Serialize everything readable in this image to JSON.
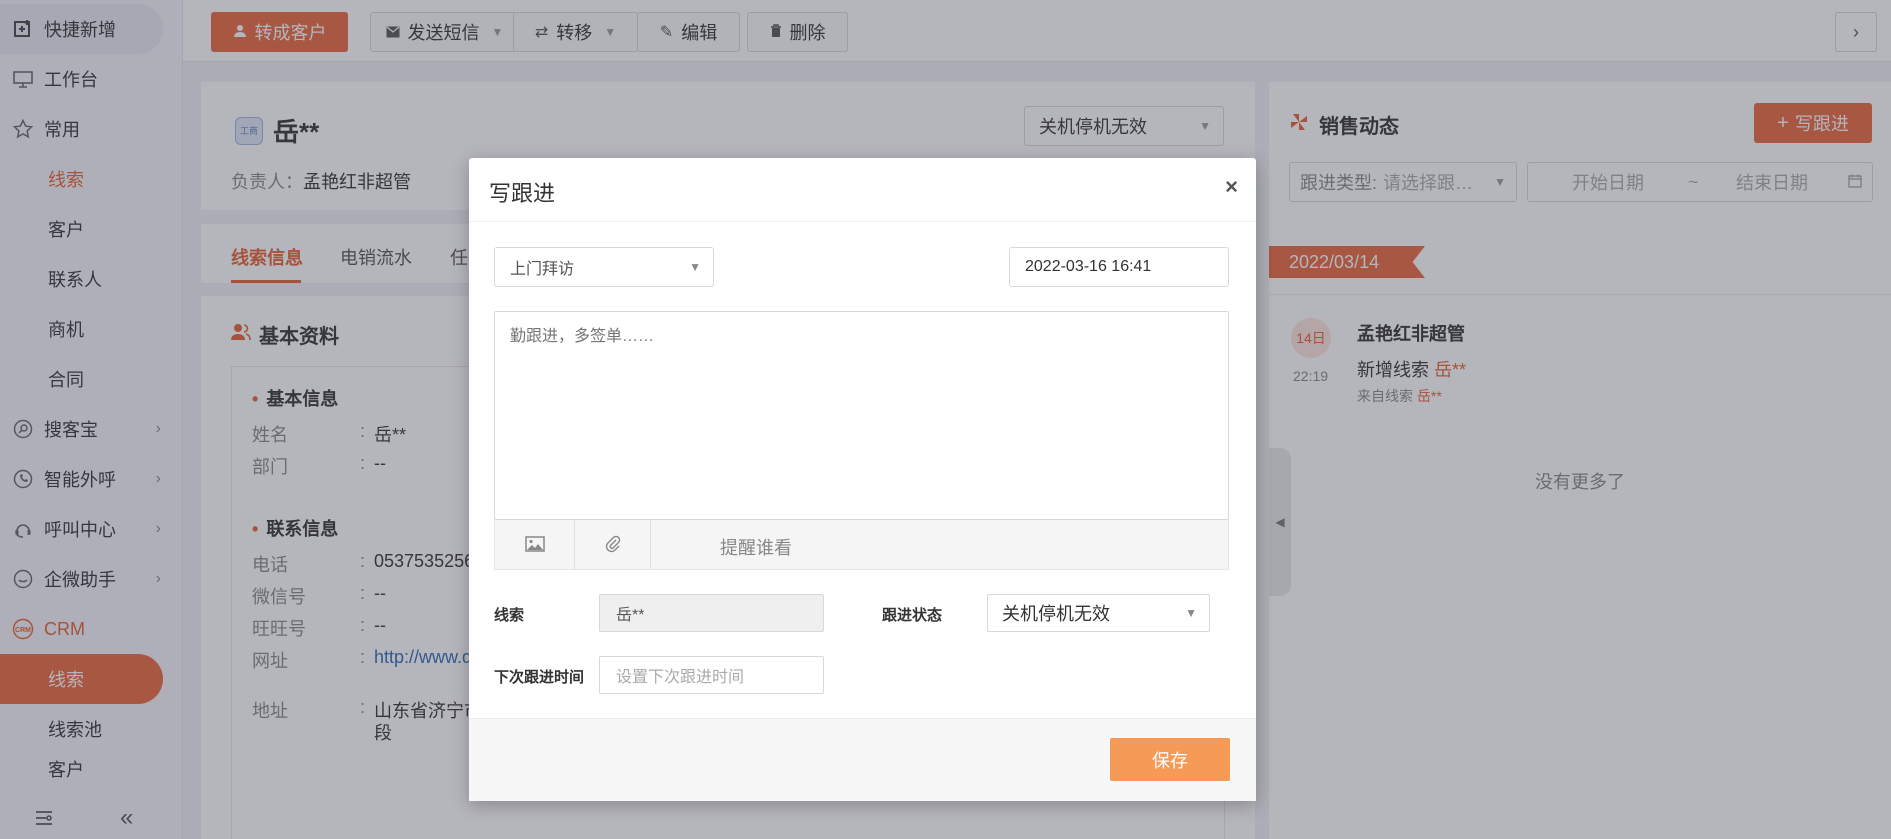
{
  "sidebar": {
    "quick_add": "快捷新增",
    "workbench": "工作台",
    "common": "常用",
    "common_items": [
      "线索",
      "客户",
      "联系人",
      "商机",
      "合同"
    ],
    "souke": "搜客宝",
    "smart_call": "智能外呼",
    "call_center": "呼叫中心",
    "wecom": "企微助手",
    "crm": "CRM",
    "crm_items": [
      "线索",
      "线索池",
      "客户"
    ]
  },
  "toolbar": {
    "convert": "转成客户",
    "sms": "发送短信",
    "transfer": "转移",
    "edit": "编辑",
    "delete": "删除"
  },
  "lead": {
    "name": "岳**",
    "badge_text": "工商",
    "owner_label": "负责人：",
    "owner": "孟艳红非超管",
    "status": "关机停机无效"
  },
  "tabs": [
    "线索信息",
    "电销流水",
    "任"
  ],
  "info": {
    "title": "基本资料",
    "section_basic": "基本信息",
    "section_contact": "联系信息",
    "fields_basic": [
      {
        "label": "姓名",
        "value": "岳**"
      },
      {
        "label": "部门",
        "value": "--"
      }
    ],
    "fields_contact": [
      {
        "label": "电话",
        "value": "05375352567"
      },
      {
        "label": "微信号",
        "value": "--"
      },
      {
        "label": "旺旺号",
        "value": "--"
      },
      {
        "label": "网址",
        "value": "http://www.d"
      },
      {
        "label": "地址",
        "value": "山东省济宁市",
        "value2": "段"
      }
    ]
  },
  "right_panel": {
    "title": "销售动态",
    "write_button": "写跟进",
    "filter_label": "跟进类型:",
    "filter_placeholder": "请选择跟…",
    "start_date": "开始日期",
    "tilde": "~",
    "end_date": "结束日期",
    "date_tag": "2022/03/14",
    "day": "14日",
    "time": "22:19",
    "user": "孟艳红非超管",
    "action_prefix": "新增线索",
    "action_name": "岳**",
    "source_prefix": "来自线索",
    "source_name": "岳**",
    "no_more": "没有更多了"
  },
  "modal": {
    "title": "写跟进",
    "close": "×",
    "type_value": "上门拜访",
    "datetime": "2022-03-16 16:41",
    "textarea_placeholder": "勤跟进，多签单……",
    "remind": "提醒谁看",
    "lead_label": "线索",
    "lead_value": "岳**",
    "status_label": "跟进状态",
    "status_value": "关机停机无效",
    "next_label": "下次跟进时间",
    "next_placeholder": "设置下次跟进时间",
    "save": "保存"
  },
  "colors": {
    "accent": "#e8683b",
    "save": "#f59a57",
    "link": "#2d6cb5"
  }
}
